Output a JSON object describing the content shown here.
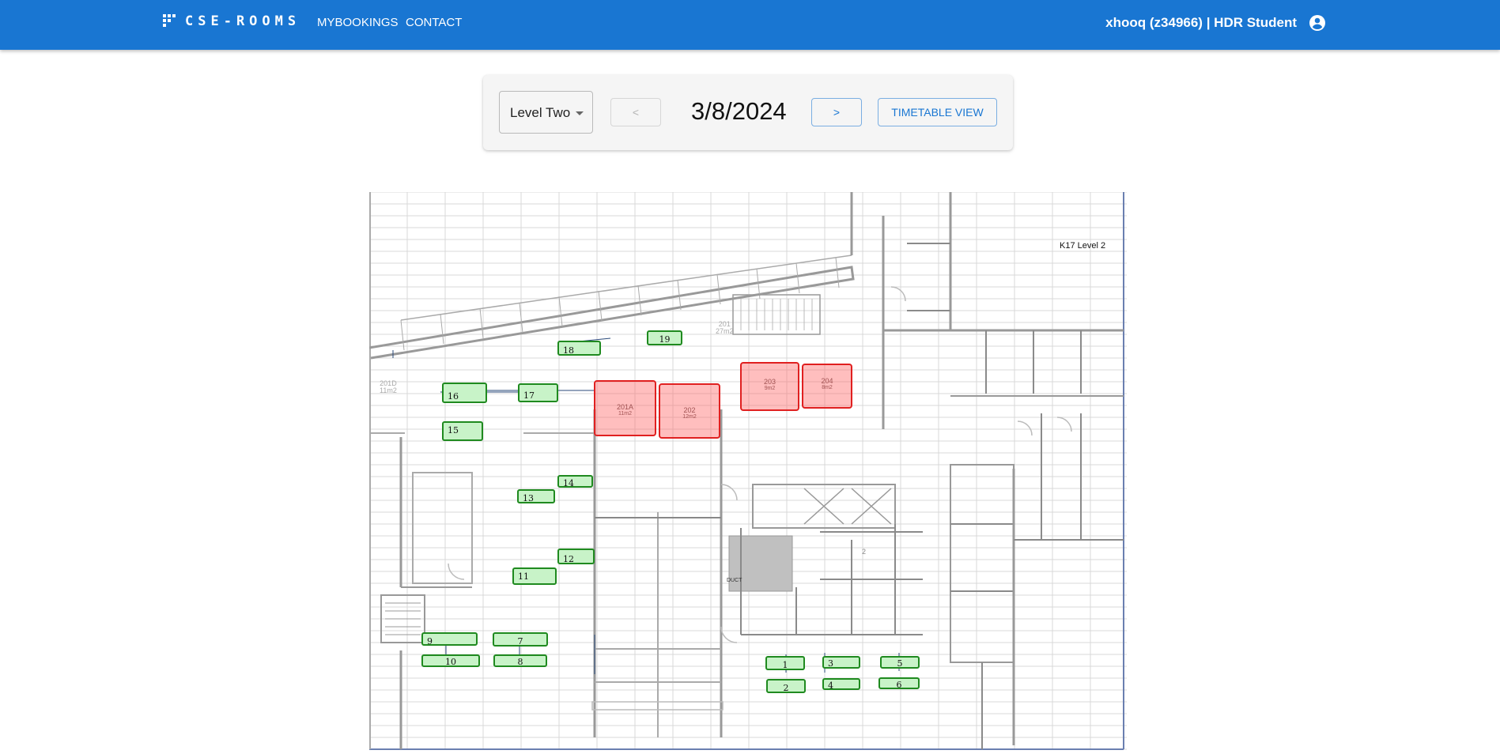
{
  "header": {
    "brand": "CSE-ROOMS",
    "nav": [
      "MYBOOKINGS",
      "CONTACT"
    ],
    "user": "xhooq (z34966) | HDR Student"
  },
  "controls": {
    "level": "Level Two",
    "prev_label": "<",
    "date": "3/8/2024",
    "next_label": ">",
    "timetable_label": "TIMETABLE VIEW"
  },
  "floorplan": {
    "title": "K17 Level 2",
    "faint_labels": [
      "201D",
      "11m2",
      "201",
      "27m2",
      "DUCT",
      "2"
    ],
    "rooms": [
      {
        "id": "201A",
        "area": "11m2",
        "status": "booked"
      },
      {
        "id": "202",
        "area": "12m2",
        "status": "booked"
      },
      {
        "id": "203",
        "area": "9m2",
        "status": "booked"
      },
      {
        "id": "204",
        "area": "8m2",
        "status": "booked"
      }
    ],
    "desks": [
      "1",
      "2",
      "3",
      "4",
      "5",
      "6",
      "7",
      "8",
      "9",
      "10",
      "11",
      "12",
      "13",
      "14",
      "15",
      "16",
      "17",
      "18",
      "19"
    ]
  },
  "colors": {
    "appbar": "#1976d2",
    "available": "#c8f3c8",
    "available_border": "#1f8a1f",
    "booked": "#ff6e6e",
    "booked_border": "#e02020"
  }
}
